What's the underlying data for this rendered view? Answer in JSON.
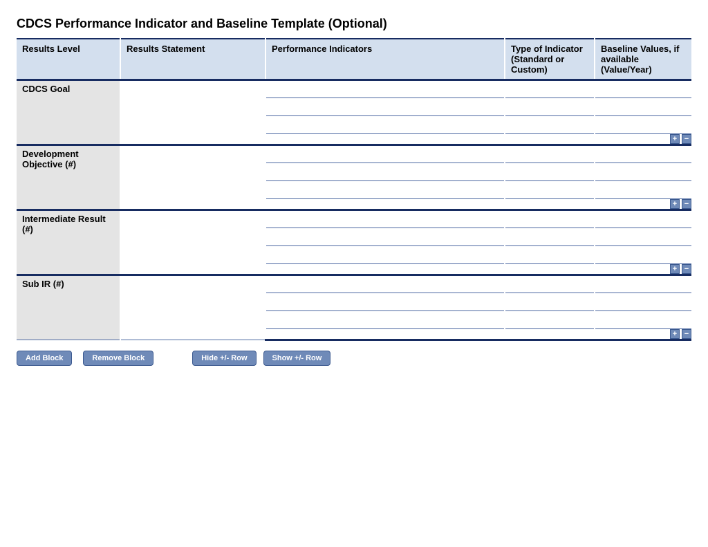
{
  "title": "CDCS Performance Indicator and Baseline Template (Optional)",
  "headers": {
    "level": "Results Level",
    "statement": "Results Statement",
    "indicator": "Performance Indicators",
    "type": "Type of Indicator (Standard or Custom)",
    "baseline": "Baseline Values, if available (Value/Year)"
  },
  "sections": [
    {
      "label": "CDCS Goal"
    },
    {
      "label": "Development Objective (#)"
    },
    {
      "label": "Intermediate Result (#)"
    },
    {
      "label": "Sub IR (#)"
    }
  ],
  "pm": {
    "plus": "+",
    "minus": "−"
  },
  "buttons": {
    "add_block": "Add Block",
    "remove_block": "Remove Block",
    "hide_row": "Hide +/- Row",
    "show_row": "Show +/- Row"
  }
}
